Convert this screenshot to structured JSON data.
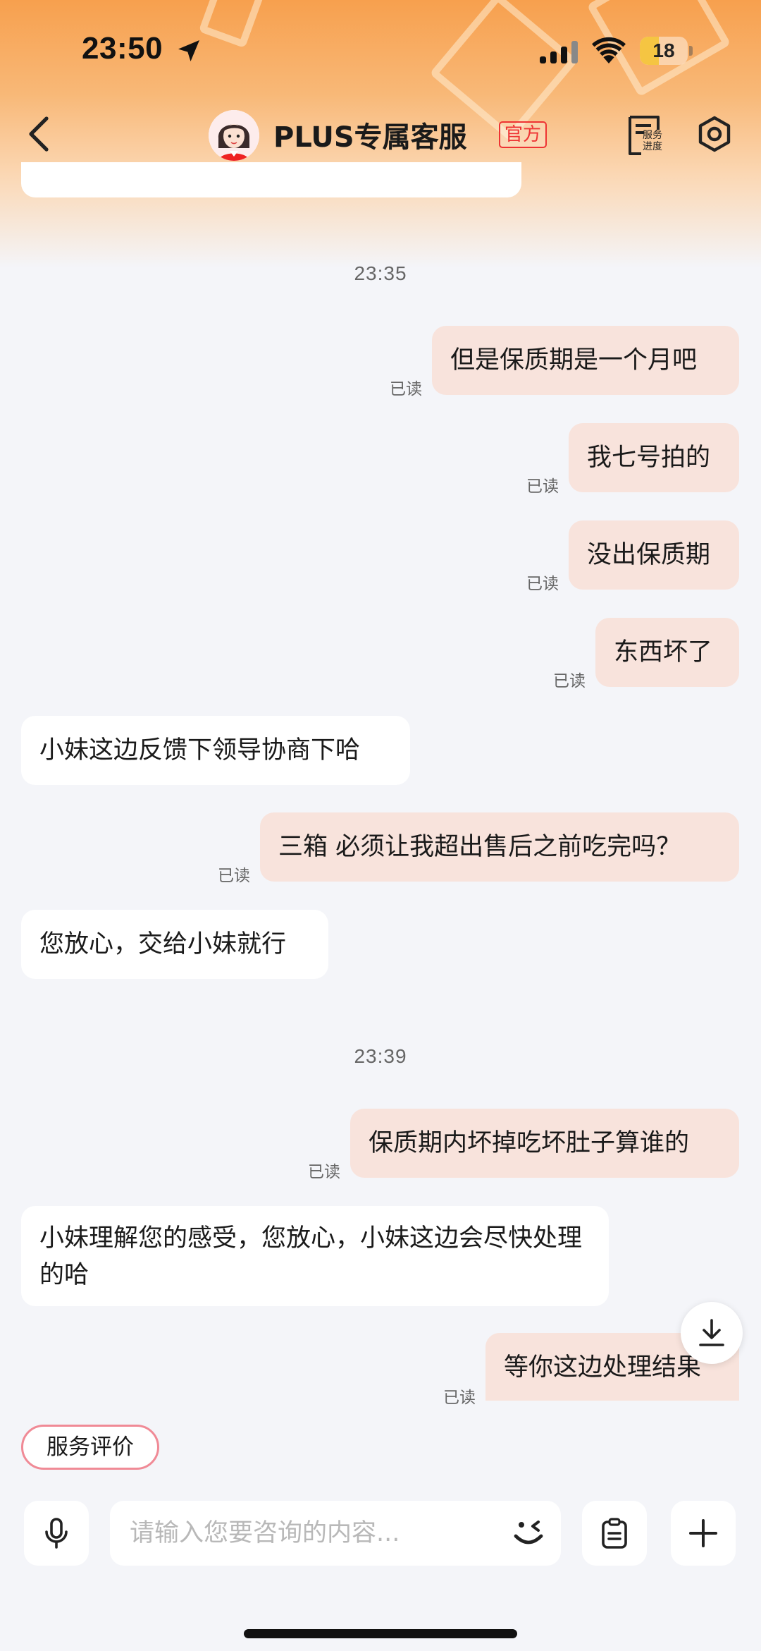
{
  "status_bar": {
    "time": "23:50",
    "battery": "18",
    "battery_level": 0.18
  },
  "header": {
    "title": "PLUS专属客服",
    "badge": "官方",
    "service_progress_label": "服务进度"
  },
  "chat": {
    "read_label": "已读",
    "timestamp_1": "23:35",
    "timestamp_2": "23:39",
    "messages": [
      {
        "side": "out",
        "text": "但是保质期是一个月吧"
      },
      {
        "side": "out",
        "text": "我七号拍的"
      },
      {
        "side": "out",
        "text": "没出保质期"
      },
      {
        "side": "out",
        "text": "东西坏了"
      },
      {
        "side": "in",
        "text": "小妹这边反馈下领导协商下哈"
      },
      {
        "side": "out",
        "text": "三箱 必须让我超出售后之前吃完吗？"
      },
      {
        "side": "in",
        "text": "您放心，交给小妹就行"
      },
      {
        "side": "out",
        "text": "保质期内坏掉吃坏肚子算谁的"
      },
      {
        "side": "in",
        "text": "小妹理解您的感受，您放心，小妹这边会尽快处理的哈"
      },
      {
        "side": "out",
        "text": "等你这边处理结果"
      }
    ]
  },
  "quick_actions": {
    "service_evaluation": "服务评价"
  },
  "input": {
    "placeholder": "请输入您要咨询的内容...",
    "value": ""
  },
  "icons": [
    "location-arrow-icon",
    "signal-icon",
    "wifi-icon",
    "back-icon",
    "service-progress-icon",
    "settings-icon",
    "scroll-down-icon",
    "microphone-icon",
    "emoji-icon",
    "clipboard-icon",
    "plus-icon"
  ],
  "colors": {
    "outgoing_bubble": "#f8e3dc",
    "incoming_bubble": "#ffffff",
    "badge_red": "#e33333",
    "header_orange": "#f7a04e"
  }
}
